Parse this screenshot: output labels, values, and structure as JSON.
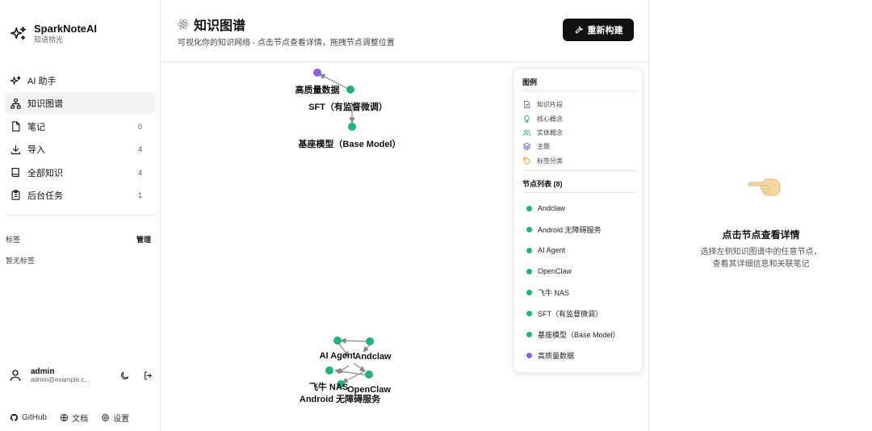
{
  "app": {
    "name": "SparkNoteAI",
    "tagline": "知语拾光"
  },
  "nav": [
    {
      "label": "AI 助手",
      "count": "",
      "icon": "sparkles-icon"
    },
    {
      "label": "知识图谱",
      "count": "",
      "icon": "network-icon",
      "active": true
    },
    {
      "label": "笔记",
      "count": "0",
      "icon": "file-icon"
    },
    {
      "label": "导入",
      "count": "4",
      "icon": "download-icon"
    },
    {
      "label": "全部知识",
      "count": "4",
      "icon": "book-icon"
    },
    {
      "label": "后台任务",
      "count": "1",
      "icon": "clipboard-icon"
    }
  ],
  "tags": {
    "header": "标签",
    "manage": "管理",
    "empty": "暂无标签"
  },
  "user": {
    "name": "admin",
    "email": "admin@example.c..."
  },
  "footer": {
    "github": "GitHub",
    "docs": "文档",
    "settings": "设置"
  },
  "header": {
    "title": "知识图谱",
    "subtitle": "可视化你的知识网络 - 点击节点查看详情，拖拽节点调整位置",
    "rebuild_label": "重新构建"
  },
  "legend": {
    "title": "图例",
    "items": [
      {
        "label": "知识片段",
        "icon": "document-icon",
        "color": "#7c5cd6"
      },
      {
        "label": "核心概念",
        "icon": "lightbulb-icon",
        "color": "#2bb673"
      },
      {
        "label": "实体概念",
        "icon": "users-icon",
        "color": "#2bb673"
      },
      {
        "label": "主题",
        "icon": "layers-icon",
        "color": "#7c5cd6"
      },
      {
        "label": "标签分类",
        "icon": "tag-icon",
        "color": "#e6a23c"
      }
    ],
    "node_list_title": "节点列表 (8)",
    "nodes": [
      {
        "label": "Andclaw",
        "color": "#1fb57a"
      },
      {
        "label": "Android 无障碍服务",
        "color": "#1fb57a"
      },
      {
        "label": "AI Agent",
        "color": "#1fb57a"
      },
      {
        "label": "OpenClaw",
        "color": "#1fb57a"
      },
      {
        "label": "飞牛 NAS",
        "color": "#1fb57a"
      },
      {
        "label": "SFT（有监督微调）",
        "color": "#1fb57a"
      },
      {
        "label": "基座模型（Base Model）",
        "color": "#1fb57a"
      },
      {
        "label": "高质量数据",
        "color": "#8e5ee0"
      }
    ]
  },
  "graph": {
    "labels": {
      "hq": "高质量数据",
      "sft": "SFT（有监督微调）",
      "base": "基座模型（Base Model）",
      "aiagent": "AI Agent",
      "andclaw": "Andclaw",
      "feiniu": "飞牛 NAS",
      "openclaw": "OpenClaw",
      "android": "Android 无障碍服务"
    }
  },
  "detail": {
    "title": "点击节点查看详情",
    "desc_line1": "选择左侧知识图谱中的任意节点，",
    "desc_line2": "查看其详细信息和关联笔记"
  }
}
